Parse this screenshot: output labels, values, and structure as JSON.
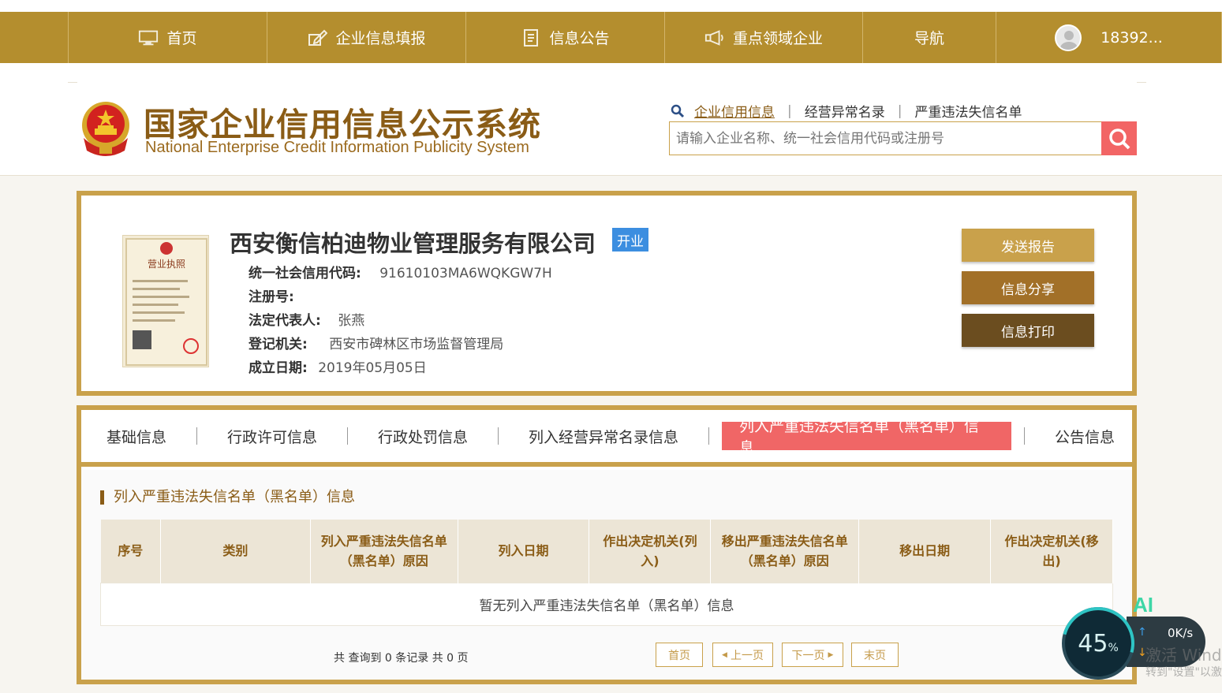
{
  "nav": {
    "items": [
      {
        "label": "首页",
        "icon": "monitor-icon"
      },
      {
        "label": "企业信息填报",
        "icon": "edit-icon"
      },
      {
        "label": "信息公告",
        "icon": "document-icon"
      },
      {
        "label": "重点领域企业",
        "icon": "megaphone-icon"
      },
      {
        "label": "导航",
        "icon": ""
      }
    ],
    "user": "18392..."
  },
  "header": {
    "title": "国家企业信用信息公示系统",
    "subtitle": "National Enterprise Credit Information Publicity System",
    "search_tabs": [
      "企业信用信息",
      "经营异常名录",
      "严重违法失信名单"
    ],
    "search_placeholder": "请输入企业名称、统一社会信用代码或注册号"
  },
  "company": {
    "name": "西安衡信柏迪物业管理服务有限公司",
    "status": "开业",
    "license_title": "营业执照",
    "fields": {
      "credit_code_label": "统一社会信用代码:",
      "credit_code": "91610103MA6WQKGW7H",
      "reg_no_label": "注册号:",
      "legal_rep_label": "法定代表人:",
      "legal_rep": "张燕",
      "authority_label": "登记机关:",
      "authority": "西安市碑林区市场监督管理局",
      "est_date_label": "成立日期:",
      "est_date": "2019年05月05日"
    },
    "actions": {
      "send_report": "发送报告",
      "share": "信息分享",
      "print": "信息打印"
    }
  },
  "tabs": {
    "items": [
      "基础信息",
      "行政许可信息",
      "行政处罚信息",
      "列入经营异常名录信息",
      "列入严重违法失信名单（黑名单）信息",
      "公告信息"
    ],
    "active_index": 4
  },
  "section": {
    "title": "列入严重违法失信名单（黑名单）信息",
    "columns": [
      "序号",
      "类别",
      "列入严重违法失信名单（黑名单）原因",
      "列入日期",
      "作出决定机关(列入)",
      "移出严重违法失信名单（黑名单）原因",
      "移出日期",
      "作出决定机关(移出)"
    ],
    "empty_text": "暂无列入严重违法失信名单（黑名单）信息"
  },
  "pager": {
    "info": "共 查询到 0 条记录 共 0 页",
    "first": "首页",
    "prev": "上一页",
    "next": "下一页",
    "last": "末页"
  },
  "overlay": {
    "percent": "45",
    "percent_unit": "%",
    "up_speed": "0K/s",
    "ai_label": "AI",
    "watermark": "激活 Wind",
    "watermark_sub": "转到\"设置\"以激"
  },
  "colors": {
    "brand_gold": "#b48e2e",
    "frame_gold": "#c9a14b",
    "active_tab": "#f06666",
    "status_blue": "#3c8ee0"
  }
}
